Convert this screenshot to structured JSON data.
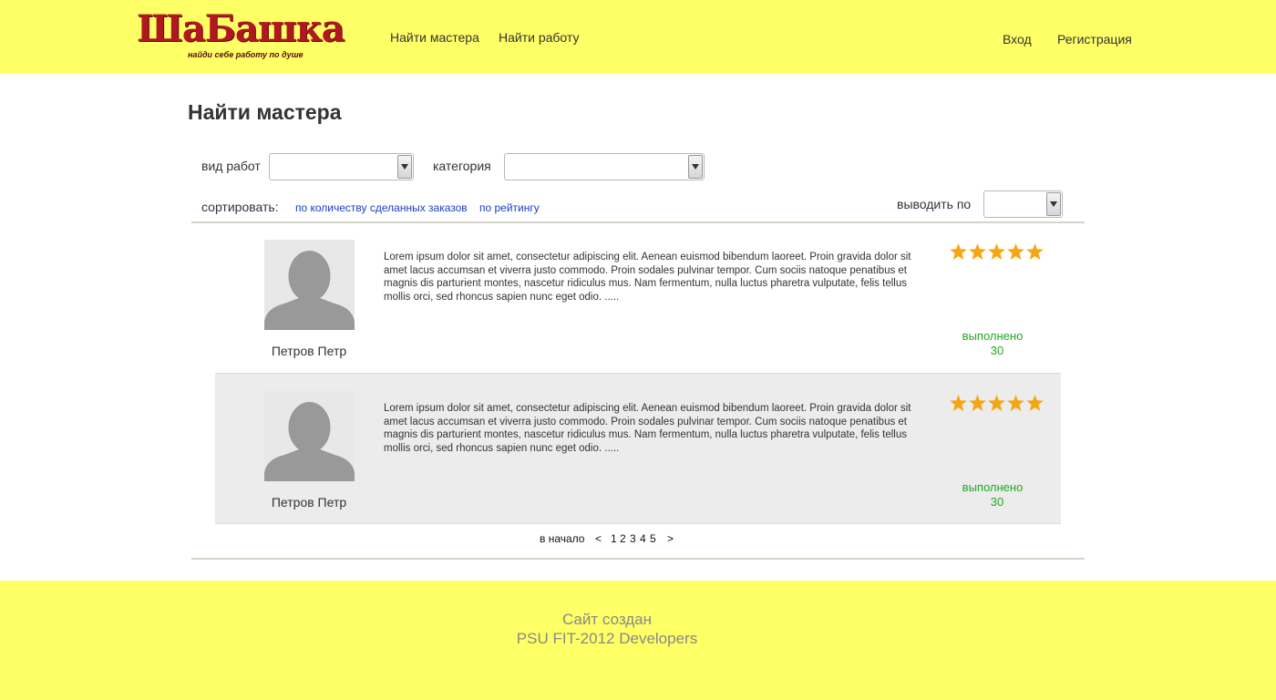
{
  "header": {
    "logo_title": "ШаБашка",
    "logo_tagline": "найди себе работу по душе",
    "nav": [
      "Найти мастера",
      "Найти работу"
    ],
    "login": "Вход",
    "register": "Регистрация"
  },
  "main": {
    "title": "Найти мастера",
    "filters": {
      "work_type_label": "вид работ",
      "category_label": "категория",
      "sort_label": "сортировать:",
      "sort_by_orders": "по количеству сделанных заказов",
      "sort_by_rating": "по рейтингу",
      "per_page_label": "выводить по"
    },
    "masters": [
      {
        "name": "Петров Петр",
        "description": "Lorem ipsum dolor sit amet, consectetur adipiscing elit. Aenean euismod bibendum laoreet. Proin gravida dolor sit amet lacus accumsan et viverra justo commodo. Proin sodales pulvinar tempor. Cum sociis natoque penatibus et magnis dis parturient montes, nascetur ridiculus mus. Nam fermentum, nulla luctus pharetra vulputate, felis tellus mollis orci, sed rhoncus sapien nunc eget odio. .....",
        "rating": 5,
        "done_label": "выполнено",
        "done_count": "30"
      },
      {
        "name": "Петров Петр",
        "description": "Lorem ipsum dolor sit amet, consectetur adipiscing elit. Aenean euismod bibendum laoreet. Proin gravida dolor sit amet lacus accumsan et viverra justo commodo. Proin sodales pulvinar tempor. Cum sociis natoque penatibus et magnis dis parturient montes, nascetur ridiculus mus. Nam fermentum, nulla luctus pharetra vulputate, felis tellus mollis orci, sed rhoncus sapien nunc eget odio. .....",
        "rating": 5,
        "done_label": "выполнено",
        "done_count": "30"
      }
    ],
    "pager": {
      "first": "в начало",
      "prev": "<",
      "pages": [
        "1",
        "2",
        "3",
        "4",
        "5"
      ],
      "next": ">"
    }
  },
  "footer": {
    "line1": "Сайт создан",
    "line2": "PSU FIT-2012 Developers"
  },
  "colors": {
    "header_bg": "#ffff66",
    "link_blue": "#1a3cc8",
    "done_green": "#22a822",
    "star_orange": "#f5a612"
  }
}
